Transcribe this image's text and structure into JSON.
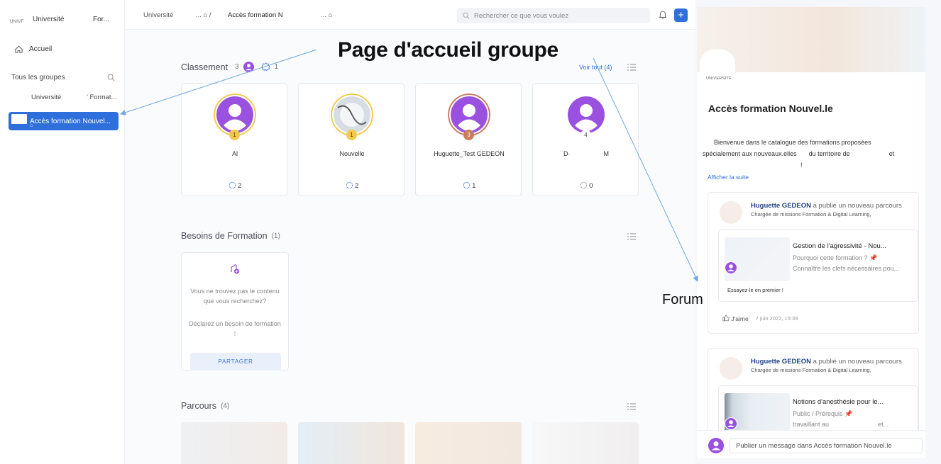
{
  "sidebar": {
    "org_mini": "UNIVF",
    "org_name": "Université",
    "org_short": "For...",
    "home_label": "Accueil",
    "groups_section": "Tous les groupes",
    "group1_a": "Université",
    "group1_b": "' Format...",
    "active_group": "Accès formation Nouvel..."
  },
  "topbar": {
    "crumb1": "Université",
    "crumb2": "... ⌂ /",
    "crumb3": "Accès formation N",
    "crumb4": "... ⌂",
    "search_placeholder": "Rechercher ce que vous voulez",
    "plus": "+"
  },
  "classement": {
    "title": "Classement",
    "members": "3",
    "points": "1",
    "voir_tout": "Voir tout (4)",
    "cards": [
      {
        "name": "Al",
        "rank": "1",
        "points": "2",
        "ring": "#f2c94c",
        "badge": "#f2c94c"
      },
      {
        "name": "Nouvelle",
        "rank": "1",
        "points": "2",
        "ring": "#f2c94c",
        "badge": "#f2c94c"
      },
      {
        "name": "Huguette_Test GEDEON",
        "rank": "3",
        "points": "1",
        "ring": "#c97b5a",
        "badge": "#c97b5a"
      },
      {
        "name_a": "D·",
        "name_b": "M",
        "rank": "4",
        "points": "0",
        "ring": "#ffffff",
        "badge": "#ffffff"
      }
    ]
  },
  "besoins": {
    "title": "Besoins de Formation",
    "count": "(1)",
    "text1": "Vous ne trouvez pas le contenu que vous recherchez?",
    "text2": "Déclarez un besoin de formation !",
    "share": "PARTAGER"
  },
  "parcours": {
    "title": "Parcours",
    "count": "(4)"
  },
  "right_panel": {
    "org": "UNIVERSITÉ",
    "title": "Accès formation Nouvel.le",
    "desc_l1": "Bienvenue dans le catalogue des formations proposées",
    "desc_l2a": "spécialement aux nouveaux.elles",
    "desc_l2b": "du territoire de",
    "desc_l2c": "et",
    "desc_l3": "!",
    "more": "Afficher la suite",
    "posts": [
      {
        "author": "Huguette GEDEON",
        "action": " a publié un nouveau parcours",
        "role": "Chargée de missions Formation & Digital Learning,",
        "course": "Gestion de l'agressivité - Nou...",
        "l1": "Pourquoi cette formation ? 📌",
        "l2": "Connaître les clefs nécessaires pou...",
        "try": "Essayez-le en premier !",
        "like": "J'aime",
        "date": "7 juin 2022, 15:39"
      },
      {
        "author": "Huguette GEDEON",
        "action": " a publié un nouveau parcours",
        "role": "Chargée de missions Formation & Digital Learning,",
        "course": "Notions d'anesthésie pour le...",
        "l1": "Public / Prérequis 📌",
        "l2a": "travaillant au",
        "l2b": "et..."
      }
    ],
    "composer_placeholder": "Publier un message dans Accès formation Nouvel.le"
  },
  "annotations": {
    "page_title": "Page d'accueil groupe",
    "forum": "Forum"
  },
  "colors": {
    "accent": "#2f6fdc",
    "avatar_purple": "#9b51e0"
  }
}
